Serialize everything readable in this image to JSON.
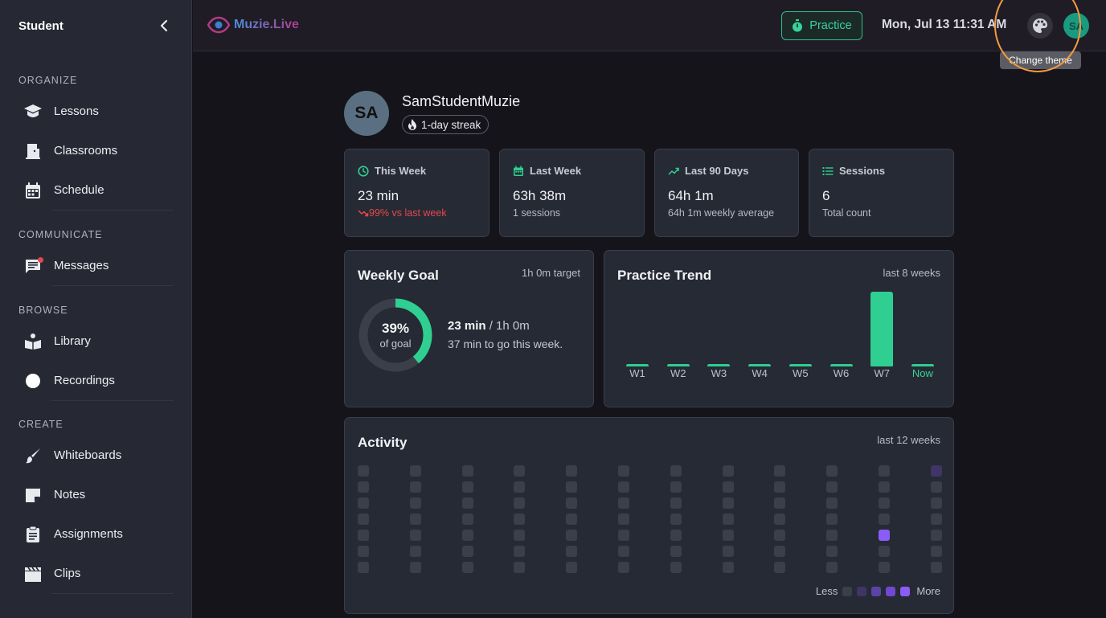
{
  "sidebar": {
    "title": "Student",
    "sections": [
      {
        "label": "ORGANIZE",
        "items": [
          {
            "label": "Lessons",
            "icon": "graduation-cap-icon"
          },
          {
            "label": "Classrooms",
            "icon": "door-icon"
          },
          {
            "label": "Schedule",
            "icon": "calendar-icon"
          }
        ]
      },
      {
        "label": "COMMUNICATE",
        "items": [
          {
            "label": "Messages",
            "icon": "message-icon",
            "badge": true
          }
        ]
      },
      {
        "label": "BROWSE",
        "items": [
          {
            "label": "Library",
            "icon": "book-reader-icon"
          },
          {
            "label": "Recordings",
            "icon": "record-circle-icon"
          }
        ]
      },
      {
        "label": "CREATE",
        "items": [
          {
            "label": "Whiteboards",
            "icon": "brush-icon"
          },
          {
            "label": "Notes",
            "icon": "note-icon"
          },
          {
            "label": "Assignments",
            "icon": "clipboard-icon"
          },
          {
            "label": "Clips",
            "icon": "clapperboard-icon"
          }
        ]
      }
    ]
  },
  "topbar": {
    "logo_text": "Muzie.Live",
    "practice_label": "Practice",
    "datetime": "Mon, Jul 13 11:31 AM",
    "avatar_initials": "SA",
    "tooltip": "Change theme"
  },
  "profile": {
    "initials": "SA",
    "name": "SamStudentMuzie",
    "streak": "1-day streak"
  },
  "stats": [
    {
      "title": "This Week",
      "value": "23 min",
      "sub": "99% vs last week",
      "negative": true,
      "icon": "clock-icon"
    },
    {
      "title": "Last Week",
      "value": "63h 38m",
      "sub": "1 sessions",
      "icon": "calendar-icon"
    },
    {
      "title": "Last 90 Days",
      "value": "64h 1m",
      "sub": "64h 1m weekly average",
      "icon": "trend-up-icon"
    },
    {
      "title": "Sessions",
      "value": "6",
      "sub": "Total count",
      "icon": "list-icon"
    }
  ],
  "weekly_goal": {
    "title": "Weekly Goal",
    "target": "1h 0m target",
    "percent": "39%",
    "percent_value": 0.39,
    "of_goal": "of goal",
    "progress_strong": "23 min",
    "progress_rest": " / 1h 0m",
    "remaining": "37 min to go this week."
  },
  "chart_data": {
    "type": "bar",
    "title": "Practice Trend",
    "subtitle": "last 8 weeks",
    "categories": [
      "W1",
      "W2",
      "W3",
      "W4",
      "W5",
      "W6",
      "W7",
      "Now"
    ],
    "values": [
      0,
      0,
      0,
      0,
      0,
      0,
      63.6,
      0.4
    ],
    "ylim": [
      0,
      64
    ]
  },
  "activity": {
    "title": "Activity",
    "subtitle": "last 12 weeks",
    "legend_less": "Less",
    "legend_more": "More",
    "legend_colors": [
      "#3b3f4a",
      "#3f3566",
      "#5a44a6",
      "#7148cf",
      "#8b5cf6"
    ],
    "active_cells": [
      {
        "week": 10,
        "day": 4,
        "level": 4
      },
      {
        "week": 11,
        "day": 0,
        "level": 1
      }
    ]
  },
  "colors": {
    "accent_green": "#2ecf91",
    "accent_purple": "#8b5cf6",
    "negative_red": "#e5484d",
    "highlight_orange": "#f39a3f"
  }
}
